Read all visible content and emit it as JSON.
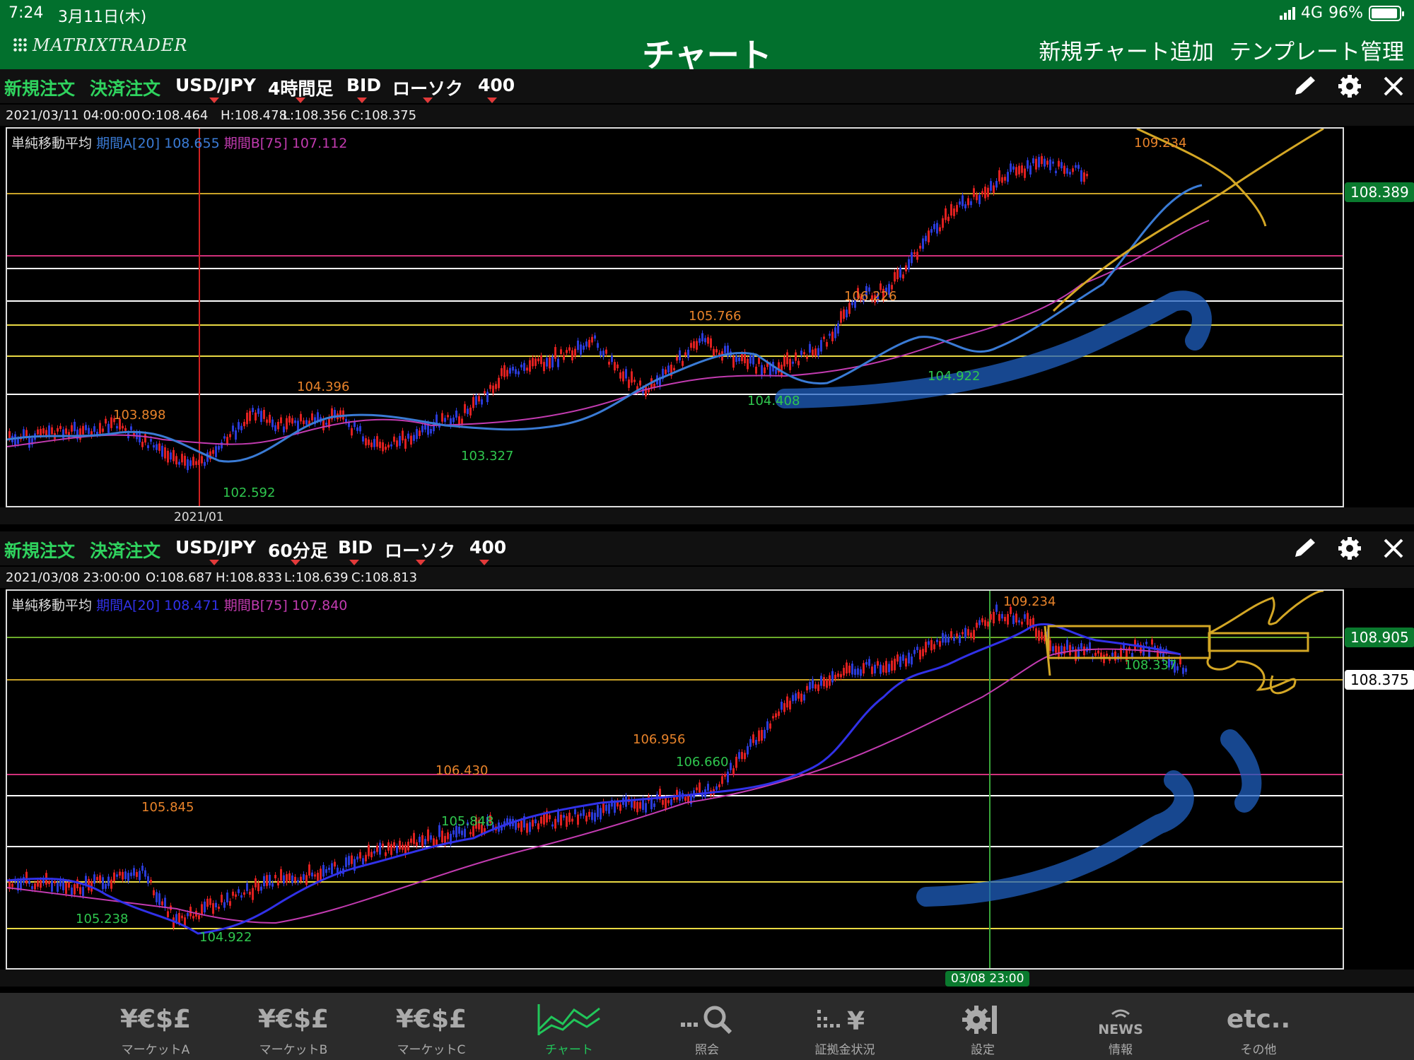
{
  "status_bar": {
    "time": "7:24",
    "date": "3月11日(木)",
    "network": "4G",
    "battery": "96%"
  },
  "nav": {
    "logo": "MATRIXTRADER",
    "title": "チャート",
    "add_chart": "新規チャート追加",
    "template_manage": "テンプレート管理"
  },
  "chart1": {
    "toolbar": {
      "new_order": "新規注文",
      "settle_order": "決済注文",
      "pair": "USD/JPY",
      "timeframe": "4時間足",
      "price_type": "BID",
      "chart_type": "ローソク",
      "bars": "400"
    },
    "ohlc": {
      "datetime": "2021/03/11 04:00:00",
      "open": "O:108.464",
      "high": "H:108.478",
      "low": "L:108.356",
      "close": "C:108.375"
    },
    "legend": {
      "label": "単純移動平均",
      "a_label": "期間A[20]",
      "a_value": "108.655",
      "b_label": "期間B[75]",
      "b_value": "107.112"
    },
    "current_price": "108.389",
    "date_label": "2021/01",
    "annotations": [
      "103.898",
      "102.592",
      "104.396",
      "103.327",
      "105.766",
      "104.408",
      "106.226",
      "104.922",
      "109.234"
    ],
    "colors": {
      "ma_a": "#3a7bd5",
      "ma_b": "#c23bb0",
      "up": "#e02020",
      "down": "#2a3bd8"
    }
  },
  "chart2": {
    "toolbar": {
      "new_order": "新規注文",
      "settle_order": "決済注文",
      "pair": "USD/JPY",
      "timeframe": "60分足",
      "price_type": "BID",
      "chart_type": "ローソク",
      "bars": "400"
    },
    "ohlc": {
      "datetime": "2021/03/08 23:00:00",
      "open": "O:108.687",
      "high": "H:108.833",
      "low": "L:108.639",
      "close": "C:108.813"
    },
    "legend": {
      "label": "単純移動平均",
      "a_label": "期間A[20]",
      "a_value": "108.471",
      "b_label": "期間B[75]",
      "b_value": "107.840"
    },
    "line_price": "108.905",
    "current_price": "108.375",
    "cursor_date": "03/08 23:00",
    "annotations": [
      "105.845",
      "105.238",
      "104.922",
      "106.430",
      "105.848",
      "106.956",
      "106.660",
      "109.234",
      "108.337"
    ],
    "colors": {
      "ma_a": "#3131e8",
      "ma_b": "#c23bb0",
      "up": "#e02020",
      "down": "#2a3bd8"
    }
  },
  "tabs": [
    {
      "icon": "¥€$£",
      "label": "マーケットA",
      "name": "market-a"
    },
    {
      "icon": "¥€$£",
      "label": "マーケットB",
      "name": "market-b"
    },
    {
      "icon": "¥€$£",
      "label": "マーケットC",
      "name": "market-c"
    },
    {
      "icon": "chart",
      "label": "チャート",
      "name": "chart",
      "active": true
    },
    {
      "icon": "search",
      "label": "照会",
      "name": "inquiry"
    },
    {
      "icon": "margin",
      "label": "証拠金状況",
      "name": "margin-status"
    },
    {
      "icon": "gear",
      "label": "設定",
      "name": "settings"
    },
    {
      "icon": "news",
      "label": "情報",
      "name": "news"
    },
    {
      "icon": "etc..",
      "label": "その他",
      "name": "other"
    }
  ]
}
